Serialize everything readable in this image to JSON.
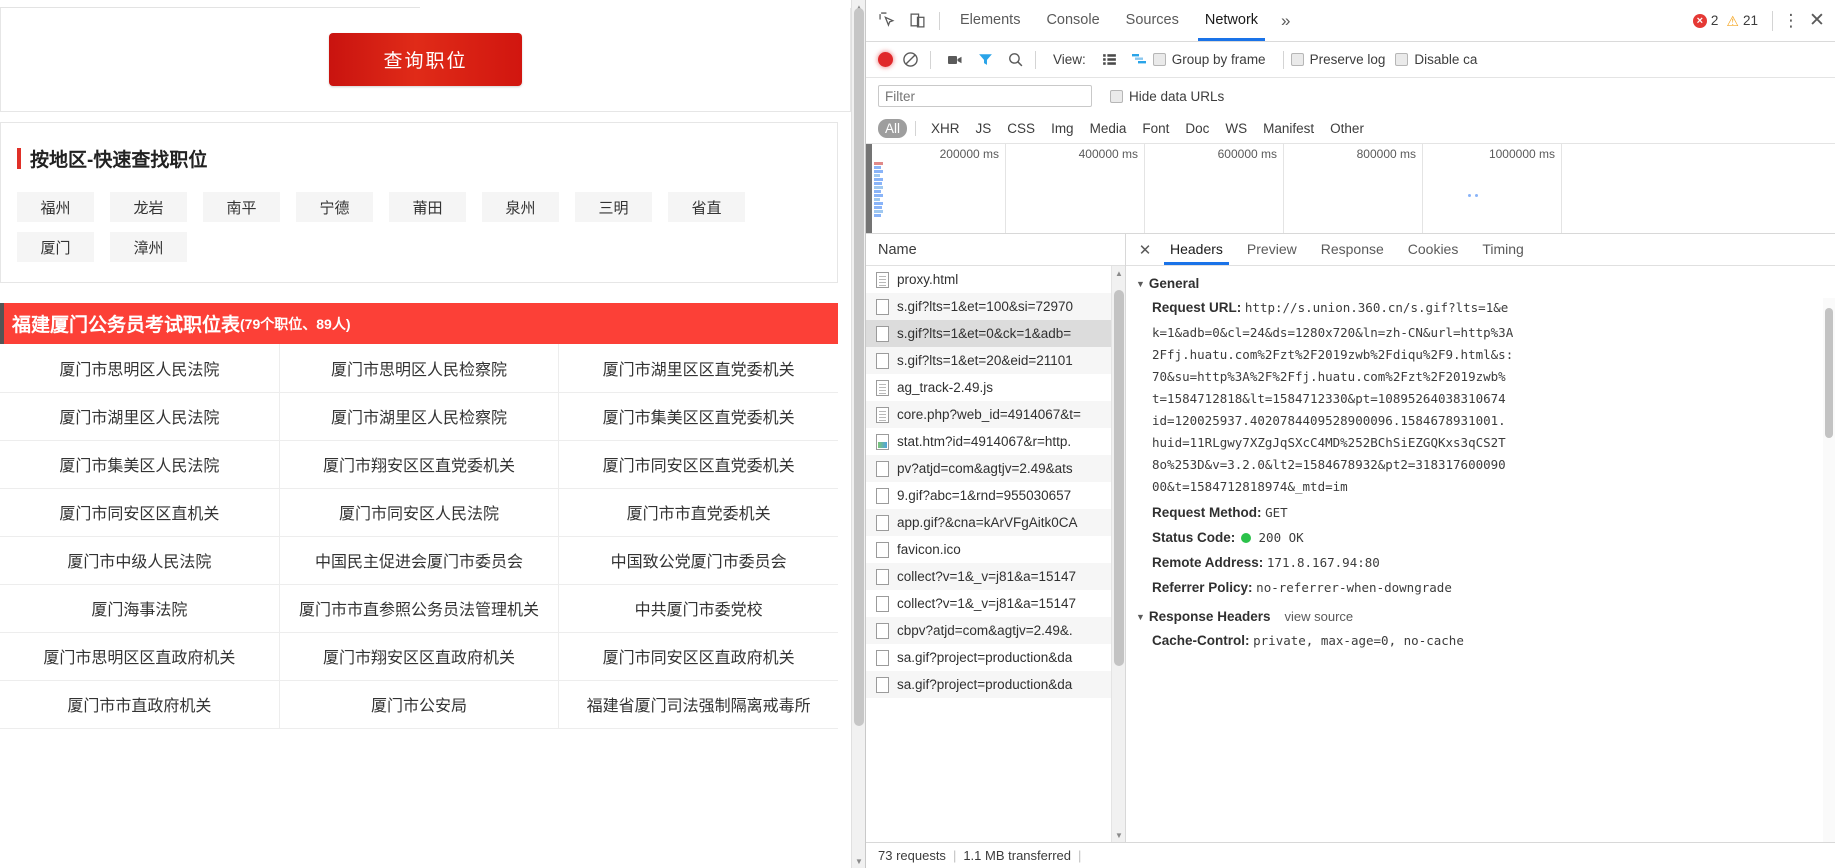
{
  "webpage": {
    "query_button": "查询职位",
    "region_section": {
      "title": "按地区-快速查找职位",
      "chips": [
        "福州",
        "龙岩",
        "南平",
        "宁德",
        "莆田",
        "泉州",
        "三明",
        "省直",
        "厦门",
        "漳州"
      ]
    },
    "jobs_table": {
      "header_main": "福建厦门公务员考试职位表",
      "header_sub": "(79个职位、89人)",
      "rows": [
        [
          "厦门市思明区人民法院",
          "厦门市思明区人民检察院",
          "厦门市湖里区区直党委机关"
        ],
        [
          "厦门市湖里区人民法院",
          "厦门市湖里区人民检察院",
          "厦门市集美区区直党委机关"
        ],
        [
          "厦门市集美区人民法院",
          "厦门市翔安区区直党委机关",
          "厦门市同安区区直党委机关"
        ],
        [
          "厦门市同安区区直机关",
          "厦门市同安区人民法院",
          "厦门市市直党委机关"
        ],
        [
          "厦门市中级人民法院",
          "中国民主促进会厦门市委员会",
          "中国致公党厦门市委员会"
        ],
        [
          "厦门海事法院",
          "厦门市市直参照公务员法管理机关",
          "中共厦门市委党校"
        ],
        [
          "厦门市思明区区直政府机关",
          "厦门市翔安区区直政府机关",
          "厦门市同安区区直政府机关"
        ],
        [
          "厦门市市直政府机关",
          "厦门市公安局",
          "福建省厦门司法强制隔离戒毒所"
        ]
      ]
    }
  },
  "devtools": {
    "tabs": [
      {
        "label": "Elements",
        "active": false
      },
      {
        "label": "Console",
        "active": false
      },
      {
        "label": "Sources",
        "active": false
      },
      {
        "label": "Network",
        "active": true
      }
    ],
    "more_tabs_label": "»",
    "errors_count": "2",
    "warnings_count": "21",
    "toolbar": {
      "view_label": "View:",
      "group_by_frame": "Group by frame",
      "preserve_log": "Preserve log",
      "disable_cache": "Disable ca"
    },
    "filter": {
      "placeholder": "Filter",
      "value": "",
      "hide_data_urls": "Hide data URLs"
    },
    "types": [
      "All",
      "XHR",
      "JS",
      "CSS",
      "Img",
      "Media",
      "Font",
      "Doc",
      "WS",
      "Manifest",
      "Other"
    ],
    "active_type": "All",
    "timeline": {
      "ticks": [
        "200000 ms",
        "400000 ms",
        "600000 ms",
        "800000 ms",
        "1000000 ms"
      ]
    },
    "requests": {
      "column_name": "Name",
      "items": [
        {
          "name": "proxy.html",
          "icon": "doc-icon",
          "selected": false
        },
        {
          "name": "s.gif?lts=1&et=100&si=72970",
          "icon": "plain-icon",
          "selected": false
        },
        {
          "name": "s.gif?lts=1&et=0&ck=1&adb=",
          "icon": "plain-icon",
          "selected": true
        },
        {
          "name": "s.gif?lts=1&et=20&eid=21101",
          "icon": "plain-icon",
          "selected": false
        },
        {
          "name": "ag_track-2.49.js",
          "icon": "doc-icon",
          "selected": false
        },
        {
          "name": "core.php?web_id=4914067&t=",
          "icon": "doc-icon",
          "selected": false
        },
        {
          "name": "stat.htm?id=4914067&r=http.",
          "icon": "img-icon",
          "selected": false
        },
        {
          "name": "pv?atjd=com&agtjv=2.49&ats",
          "icon": "plain-icon",
          "selected": false
        },
        {
          "name": "9.gif?abc=1&rnd=955030657",
          "icon": "plain-icon",
          "selected": false
        },
        {
          "name": "app.gif?&cna=kArVFgAitk0CA",
          "icon": "plain-icon",
          "selected": false
        },
        {
          "name": "favicon.ico",
          "icon": "plain-icon",
          "selected": false
        },
        {
          "name": "collect?v=1&_v=j81&a=15147",
          "icon": "plain-icon",
          "selected": false
        },
        {
          "name": "collect?v=1&_v=j81&a=15147",
          "icon": "plain-icon",
          "selected": false
        },
        {
          "name": "cbpv?atjd=com&agtjv=2.49&.",
          "icon": "plain-icon",
          "selected": false
        },
        {
          "name": "sa.gif?project=production&da",
          "icon": "plain-icon",
          "selected": false
        },
        {
          "name": "sa.gif?project=production&da",
          "icon": "plain-icon",
          "selected": false
        }
      ]
    },
    "detail": {
      "tabs": [
        {
          "label": "Headers",
          "active": true
        },
        {
          "label": "Preview",
          "active": false
        },
        {
          "label": "Response",
          "active": false
        },
        {
          "label": "Cookies",
          "active": false
        },
        {
          "label": "Timing",
          "active": false
        }
      ],
      "general_title": "General",
      "request_url_label": "Request URL:",
      "request_url_lines": [
        "http://s.union.360.cn/s.gif?lts=1&e",
        "k=1&adb=0&cl=24&ds=1280x720&ln=zh-CN&url=http%3A",
        "2Ffj.huatu.com%2Fzt%2F2019zwb%2Fdiqu%2F9.html&s:",
        "70&su=http%3A%2F%2Ffj.huatu.com%2Fzt%2F2019zwb%",
        "t=1584712818&lt=1584712330&pt=10895264038310674",
        "id=120025937.4020784409528900096.1584678931001.",
        "huid=11RLgwy7XZgJqSXcC4MD%252BChSiEZGQKxs3qCS2T",
        "8o%253D&v=3.2.0&lt2=1584678932&pt2=318317600090",
        "00&t=1584712818974&_mtd=im"
      ],
      "request_method_label": "Request Method:",
      "request_method_value": "GET",
      "status_code_label": "Status Code:",
      "status_code_value": "200 OK",
      "remote_address_label": "Remote Address:",
      "remote_address_value": "171.8.167.94:80",
      "referrer_policy_label": "Referrer Policy:",
      "referrer_policy_value": "no-referrer-when-downgrade",
      "response_headers_title": "Response Headers",
      "view_source": "view source",
      "cache_control_label": "Cache-Control:",
      "cache_control_value": "private, max-age=0, no-cache"
    },
    "status_bar": {
      "requests": "73 requests",
      "transferred": "1.1 MB transferred"
    }
  }
}
